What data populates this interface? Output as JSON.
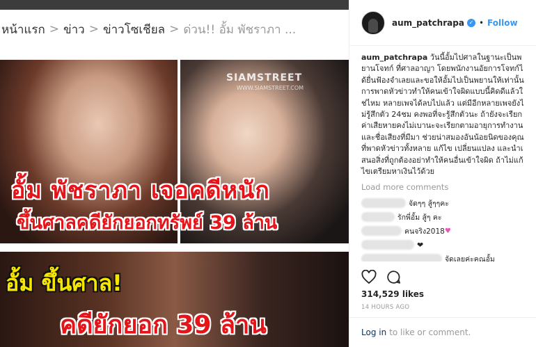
{
  "post_image": {
    "breadcrumb": [
      "หน้าแรก",
      "ข่าว",
      "ข่าวโซเชียล",
      "ด่วน!! อั้ม พัชราภา ..."
    ],
    "breadcrumb_sep": ">",
    "watermark": "SIAMSTREET",
    "watermark_url": "WWW.SIAMSTREET.COM",
    "headline_1": "อั้ม พัชราภา เจอคดีหนัก",
    "headline_2": "ขึ้นศาลคดียักยอกทรัพย์ 39 ล้าน",
    "headline_3": "อั้ม ขึ้นศาล!",
    "headline_4": "คดียักยอก 39 ล้าน"
  },
  "header": {
    "username": "aum_patchrapa",
    "separator": "•",
    "follow_label": "Follow"
  },
  "caption": {
    "username": "aum_patchrapa",
    "text": "วันนี้อั้มไปศาลในฐานะเป็นพยานโจทก์ ที่ศาลอาญา โดยพนักงานอัยการโจทก์ได้ยื่นฟ้องจำเลยและขอให้อั้มไปเป็นพยานให้เท่านั้น การพาดหัวข่าวทำให้คนเข้าใจผิดแบบนี้คิดดีแล้วใช่ไหม หลายเพจได้ลบไปแล้ว แต่มีอีกหลายเพจยังไม่รู้สึกตัว 24ชม คงพอที่จะรู้สึกตัวนะ ถ้ายังจะเรียกค่าเสียหายคงไม่เบานะจะเรียกตามอายุการทำงานและชื่อเสียงที่มีมา ช่วยน่าสมองอันน้อยนิดของคุณที่พาดหัวข่าวทั้งหลาย แก้ไข เปลี่ยนแปลง และนำเสนอสิ่งที่ถูกต้องอย่าทำให้คนอื่นเข้าใจผิด ถ้าไม่แก้ไขเตรียมหาเงินไว้ด้วย"
  },
  "load_more_label": "Load more comments",
  "comments": [
    {
      "text": "จัดๆๆ สู้ๆๆคะ"
    },
    {
      "text": "รักพี่อั้ม สู้ๆ คะ"
    },
    {
      "text": "คนจริง2018"
    },
    {
      "text": ""
    },
    {
      "text": "จัดเลยค่ะคุณอั้ม"
    }
  ],
  "likes": "314,529 likes",
  "timestamp": "14 HOURS AGO",
  "login": {
    "link": "Log in",
    "rest": "to like or comment."
  },
  "colors": {
    "accent": "#3897f0",
    "headline_red": "#e3151a",
    "headline_yellow": "#f6e600"
  },
  "icons": [
    "heart-icon",
    "comment-icon",
    "verified-badge-icon"
  ]
}
